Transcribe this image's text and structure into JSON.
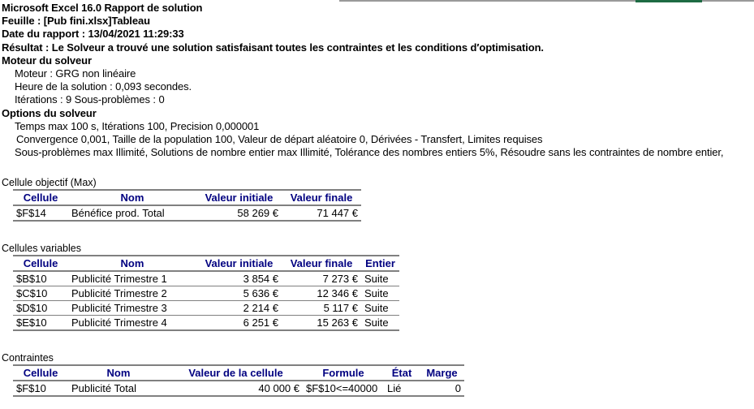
{
  "report": {
    "title": "Microsoft Excel 16.0 Rapport de solution",
    "sheet": "Feuille : [Pub fini.xlsx]Tableau",
    "date": "Date du rapport : 13/04/2021 11:29:33",
    "result": "Résultat : Le Solveur a trouvé une solution satisfaisant toutes les contraintes et les conditions d′optimisation.",
    "engine_heading": "Moteur du solveur",
    "engine_lines": [
      "Moteur : GRG non linéaire",
      "Heure de la solution : 0,093 secondes.",
      "Itérations : 9 Sous-problèmes : 0"
    ],
    "options_heading": "Options du solveur",
    "options_lines": [
      "Temps max 100 s,  Itérations 100, Precision 0,000001",
      " Convergence 0,001, Taille de la population 100, Valeur de départ aléatoire 0, Dérivées - Transfert, Limites requises",
      "Sous-problèmes max Illimité, Solutions de nombre entier max Illimité, Tolérance des nombres entiers 5%, Résoudre sans les contraintes de nombre entier,"
    ]
  },
  "objective": {
    "caption": "Cellule objectif (Max)",
    "headers": [
      "Cellule",
      "Nom",
      "Valeur initiale",
      "Valeur finale"
    ],
    "rows": [
      {
        "cellule": "$F$14",
        "nom": "Bénéfice prod. Total",
        "valeur_initiale": "58 269 €",
        "valeur_finale": "71 447 €"
      }
    ]
  },
  "variables": {
    "caption": "Cellules variables",
    "headers": [
      "Cellule",
      "Nom",
      "Valeur initiale",
      "Valeur finale",
      "Entier"
    ],
    "rows": [
      {
        "cellule": "$B$10",
        "nom": "Publicité Trimestre 1",
        "valeur_initiale": "3 854 €",
        "valeur_finale": "7 273 €",
        "entier": "Suite"
      },
      {
        "cellule": "$C$10",
        "nom": "Publicité Trimestre 2",
        "valeur_initiale": "5 636 €",
        "valeur_finale": "12 346 €",
        "entier": "Suite"
      },
      {
        "cellule": "$D$10",
        "nom": "Publicité Trimestre 3",
        "valeur_initiale": "2 214 €",
        "valeur_finale": "5 117 €",
        "entier": "Suite"
      },
      {
        "cellule": "$E$10",
        "nom": "Publicité Trimestre 4",
        "valeur_initiale": "6 251 €",
        "valeur_finale": "15 263 €",
        "entier": "Suite"
      }
    ]
  },
  "constraints": {
    "caption": "Contraintes",
    "headers": [
      "Cellule",
      "Nom",
      "Valeur de la cellule",
      "Formule",
      "État",
      "Marge"
    ],
    "rows": [
      {
        "cellule": "$F$10",
        "nom": "Publicité Total",
        "valeur": "40 000 €",
        "formule": "$F$10<=40000",
        "etat": "Lié",
        "marge": "0"
      }
    ]
  },
  "colors": {
    "header_text": "#000080",
    "rule": "#808080",
    "top_rule": "#9a9a9a",
    "top_rule_accent": "#1d6b43"
  }
}
